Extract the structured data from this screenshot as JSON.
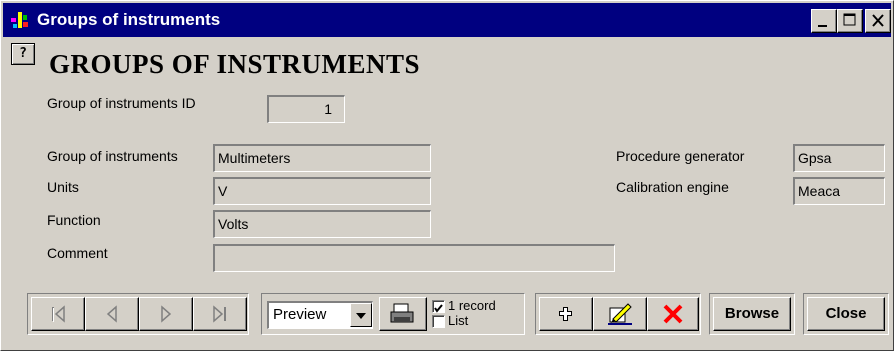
{
  "window": {
    "title": "Groups of instruments",
    "minimize_icon": "minimize-icon",
    "maximize_icon": "maximize-icon",
    "close_icon": "close-icon"
  },
  "help_icon": "?",
  "page_title": "GROUPS OF INSTRUMENTS",
  "form": {
    "group_id_label": "Group of instruments ID",
    "group_id_value": "1",
    "group_label": "Group of instruments",
    "group_value": "Multimeters",
    "units_label": "Units",
    "units_value": "V",
    "function_label": "Function",
    "function_value": "Volts",
    "comment_label": "Comment",
    "comment_value": "",
    "procedure_generator_label": "Procedure generator",
    "procedure_generator_value": "Gpsa",
    "calibration_engine_label": "Calibration engine",
    "calibration_engine_value": "Meaca"
  },
  "toolbar": {
    "nav_icons": [
      "first-record-icon",
      "previous-record-icon",
      "next-record-icon",
      "last-record-icon"
    ],
    "output_select": "Preview",
    "print_icon": "printer-icon",
    "one_record_label": "1 record",
    "one_record_checked": true,
    "list_label": "List",
    "list_checked": false,
    "add_icon": "plus-icon",
    "edit_icon": "edit-icon",
    "delete_icon": "delete-x-icon",
    "browse_label": "Browse",
    "close_label": "Close"
  },
  "colors": {
    "titlebar": "#000080",
    "background": "#d4d0c8",
    "delete": "#ff0000"
  }
}
